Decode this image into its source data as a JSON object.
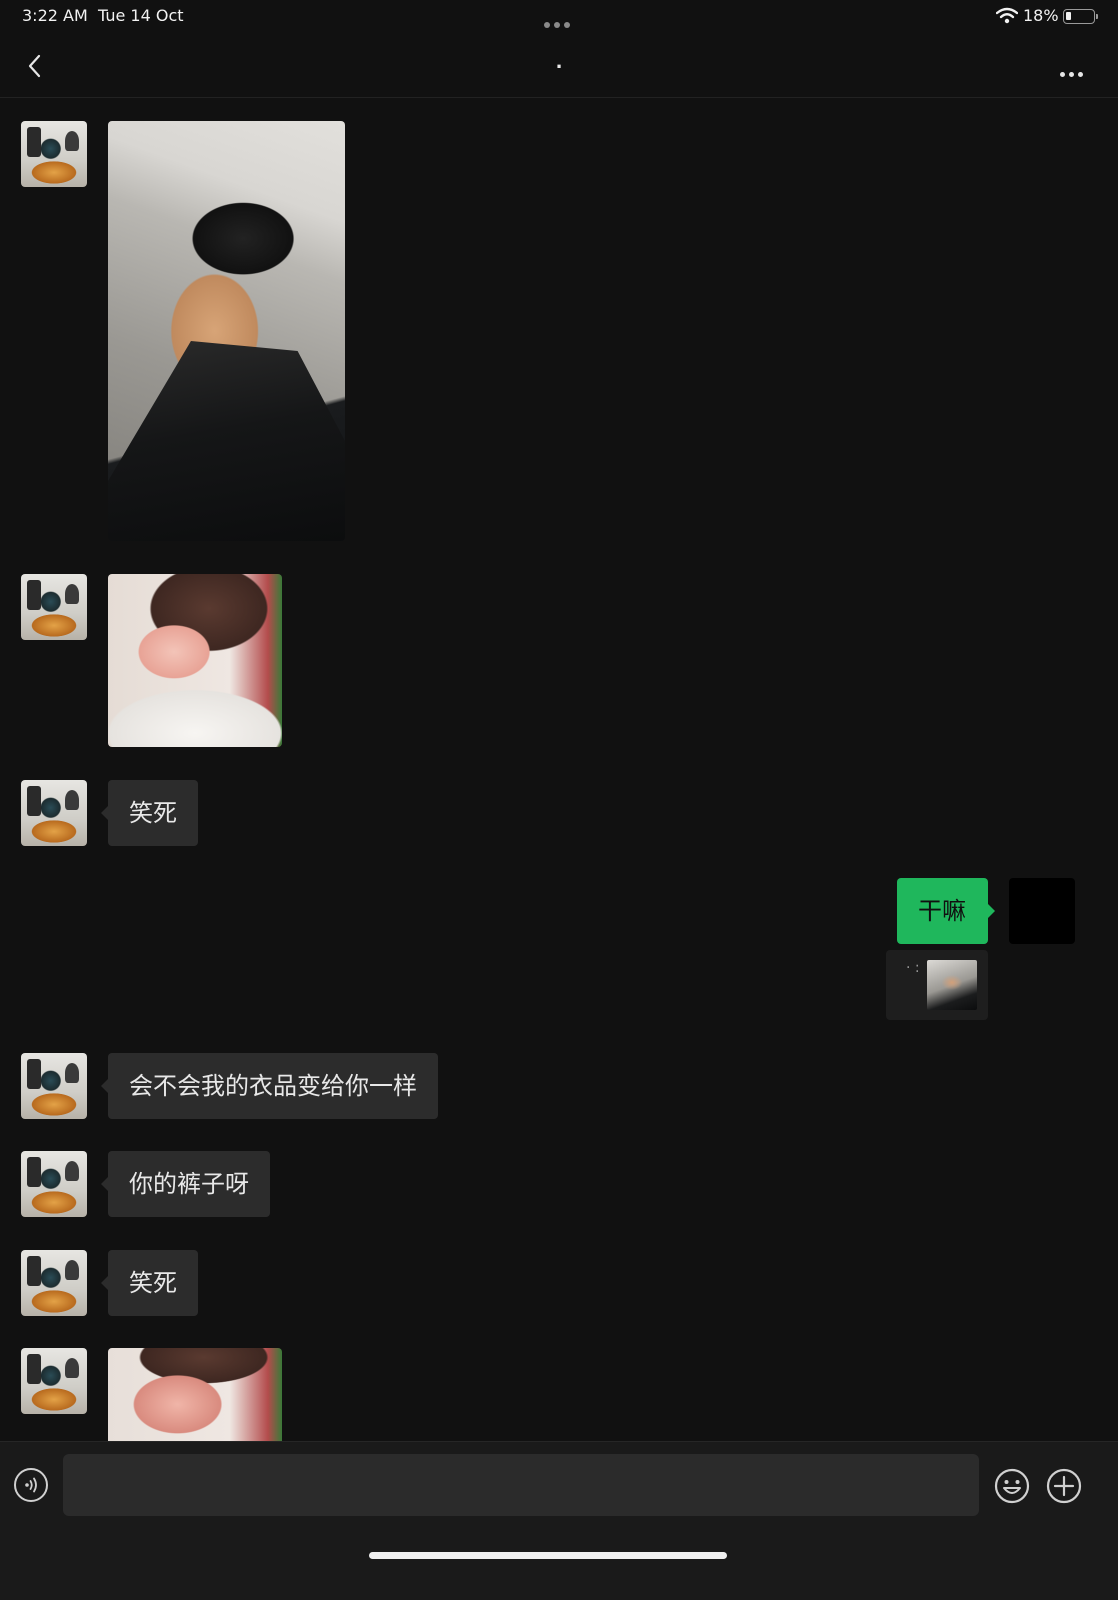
{
  "status_bar": {
    "time": "3:22 AM",
    "date": "Tue 14 Oct",
    "battery_percent": "18%",
    "battery_level": 0.18
  },
  "nav": {
    "title": ".",
    "back_icon": "chevron-left-icon",
    "more_icon": "ellipsis-icon"
  },
  "messages": [
    {
      "side": "in",
      "type": "image",
      "image": "leg-photo"
    },
    {
      "side": "in",
      "type": "image",
      "image": "girl-photo"
    },
    {
      "side": "in",
      "type": "text",
      "text": "笑死"
    },
    {
      "side": "out",
      "type": "text",
      "text": "干嘛",
      "quote_text": "· :"
    },
    {
      "side": "in",
      "type": "text",
      "text": "会不会我的衣品变给你一样"
    },
    {
      "side": "in",
      "type": "text",
      "text": "你的裤子呀"
    },
    {
      "side": "in",
      "type": "text",
      "text": "笑死"
    },
    {
      "side": "in",
      "type": "image",
      "image": "girl-photo-2"
    }
  ],
  "input": {
    "value": "",
    "placeholder": ""
  },
  "colors": {
    "background": "#111111",
    "incoming_bubble": "#2c2c2c",
    "outgoing_bubble": "#1fb75c"
  }
}
